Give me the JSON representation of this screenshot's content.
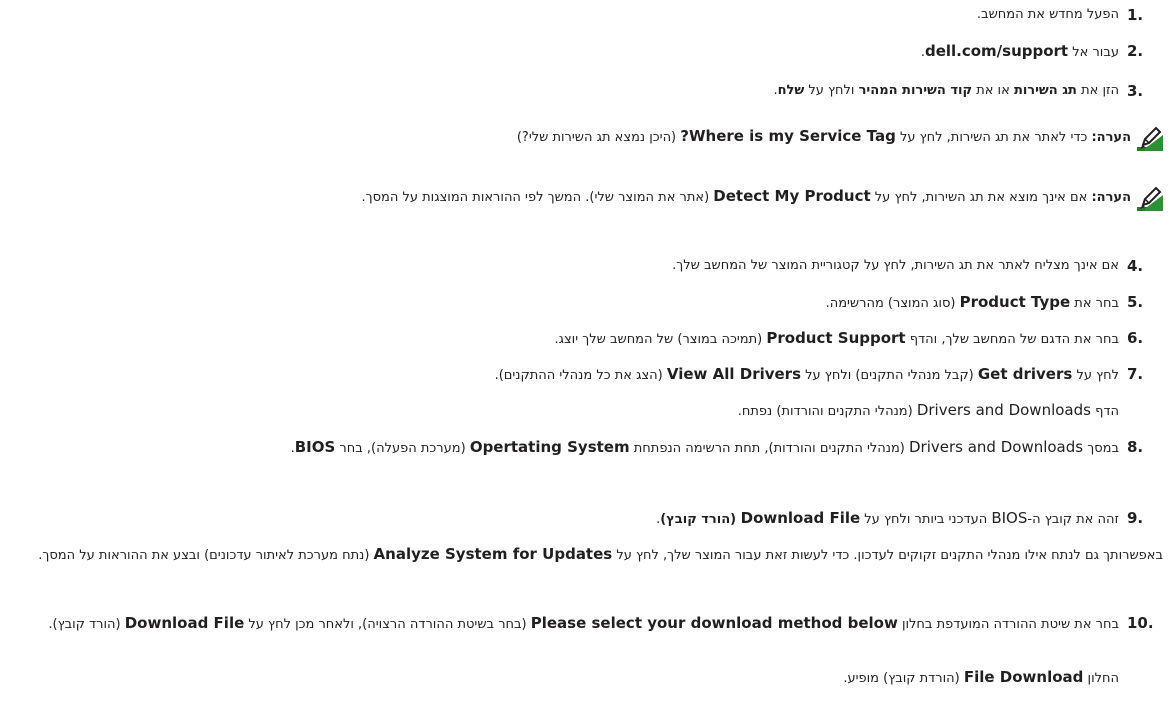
{
  "steps": [
    {
      "num": "1.",
      "text": "הפעל מחדש את המחשב."
    },
    {
      "num": "2.",
      "t1": "עבור אל ",
      "link": "dell.com/support",
      "t2": "."
    },
    {
      "num": "3.",
      "t1": "הזן את ",
      "b1": "תג השירות",
      "t2": " או את ",
      "b2": "קוד השירות המהיר",
      "t3": " ולחץ על ",
      "b3": "שלח",
      "t4": "."
    },
    {
      "num": "4.",
      "text": "אם אינך מצליח לאתר את תג השירות, לחץ על קטגוריית המוצר של המחשב שלך."
    },
    {
      "num": "5.",
      "t1": "בחר את ",
      "b1": "Product Type",
      "t2": " (סוג המוצר) מהרשימה."
    },
    {
      "num": "6.",
      "t1": "בחר את הדגם של המחשב שלך, והדף ",
      "b1": "Product Support",
      "t2": " (תמיכה במוצר) של המחשב שלך יוצג."
    },
    {
      "num": "7.",
      "t1": "לחץ על ",
      "b1": "Get drivers",
      "t2": " (קבל מנהלי התקנים) ולחץ על ",
      "b2": "View All Drivers",
      "t3": " (הצג את כל מנהלי ההתקנים).",
      "sub_t1": "הדף ",
      "sub_l1": "Drivers and Downloads",
      "sub_t2": " (מנהלי התקנים והורדות) נפתח."
    },
    {
      "num": "8.",
      "t1": "במסך ",
      "l1": "Drivers and Downloads",
      "t2": " (מנהלי התקנים והורדות), תחת הרשימה הנפתחת ",
      "b1": "Opertating System",
      "t3": " (מערכת הפעלה), בחר ",
      "b2": "BIOS",
      "t4": "."
    },
    {
      "num": "9.",
      "t1": "זהה את קובץ ה-",
      "l1": "BIOS",
      "t2": " העדכני ביותר ולחץ על ",
      "b1": "Download File",
      "b2": " (הורד קובץ)",
      "t3": "."
    },
    {
      "num": "10.",
      "t1": "בחר את שיטת ההורדה המועדפת בחלון ",
      "b1": "Please select your download method below",
      "t2": " (בחר בשיטת ההורדה הרצויה), ולאחר מכן לחץ על ",
      "b2": "Download File",
      "t3": " (הורד קובץ).",
      "sub_t1": "החלון ",
      "sub_b1": "File Download",
      "sub_t2": " (הורדת קובץ) מופיע."
    }
  ],
  "notes": [
    {
      "label": "הערה:",
      "t1": " כדי לאתר את תג השירות, לחץ על ",
      "b1": "Where is my Service Tag?",
      "t2": " (היכן נמצא תג השירות שלי?)"
    },
    {
      "label": "הערה:",
      "t1": " אם אינך מוצא את תג השירות, לחץ על ",
      "b1": "Detect My Product",
      "t2": " (אתר את המוצר שלי). המשך לפי ההוראות המוצגות על המסך."
    }
  ],
  "paragraph9": {
    "t1": "באפשרותך גם לנתח אילו מנהלי התקנים זקוקים לעדכון. כדי לעשות זאת עבור המוצר שלך, לחץ על ",
    "b1": "Analyze System for Updates",
    "t2": " (נתח מערכת לאיתור עדכונים) ובצע את ההוראות על המסך."
  },
  "icons": {
    "note": "note-pencil-icon"
  }
}
